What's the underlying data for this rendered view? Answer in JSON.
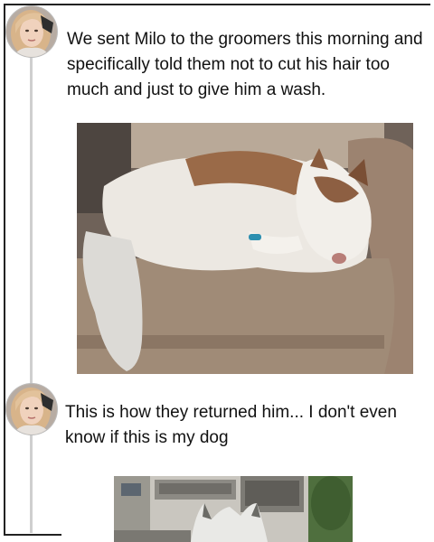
{
  "thread": {
    "posts": [
      {
        "avatar_icon": "profile-avatar",
        "text": "We sent Milo to the groomers this morning and specifically told them not to cut his hair too much and just to give him a wash.",
        "image": "husky-sleeping-on-sofa-photo"
      },
      {
        "avatar_icon": "profile-avatar",
        "text": "This is how they returned him... I don't even know if this is my dog",
        "image": "groomed-dog-on-balcony-photo"
      }
    ]
  },
  "colors": {
    "frame": "#222222",
    "thread_line": "#cfcfcf",
    "text": "#111111",
    "background": "#ffffff"
  }
}
